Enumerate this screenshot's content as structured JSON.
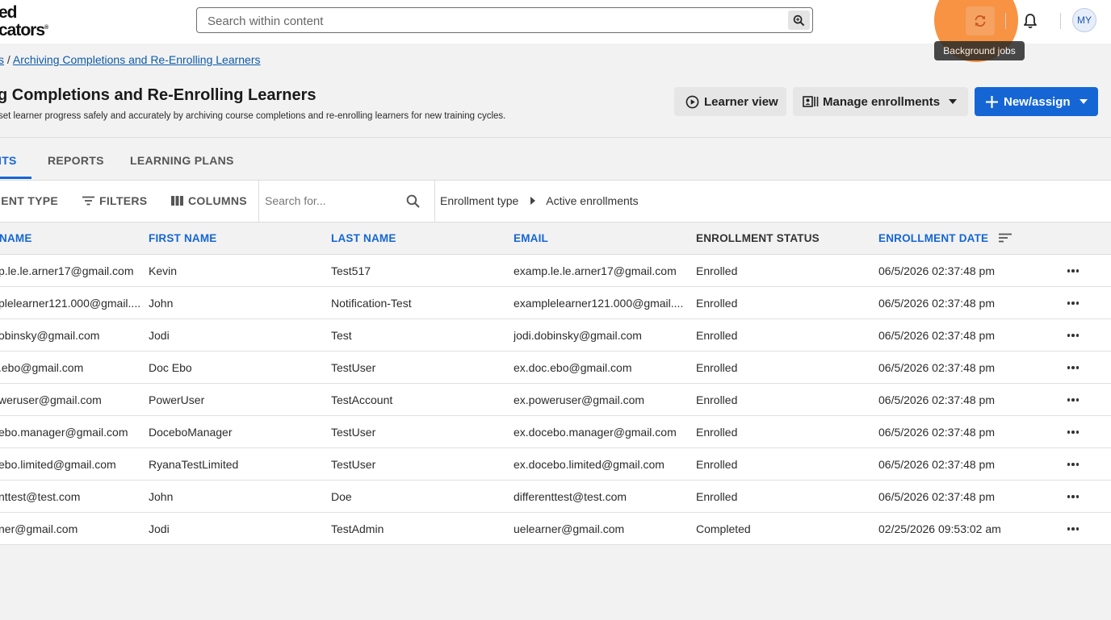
{
  "logo": {
    "line1": "ed",
    "line2": "cators"
  },
  "search": {
    "placeholder": "Search within content"
  },
  "header": {
    "tooltip": "Background jobs",
    "avatar": "MY"
  },
  "breadcrumb": {
    "prefix": "s",
    "separator": "/",
    "current": "Archiving Completions and Re-Enrolling Learners"
  },
  "page": {
    "title": "g Completions and Re-Enrolling Learners",
    "subtitle": "set learner progress safely and accurately by archiving course completions and re-enrolling learners for new training cycles."
  },
  "actions": {
    "learner_view": "Learner view",
    "manage_enrollments": "Manage enrollments",
    "new_assign": "New/assign"
  },
  "tabs": [
    {
      "label": "ITS"
    },
    {
      "label": "REPORTS"
    },
    {
      "label": "LEARNING PLANS"
    }
  ],
  "toolbar": {
    "enrollment_type": "IENT TYPE",
    "filters": "FILTERS",
    "columns": "COLUMNS",
    "search_placeholder": "Search for...",
    "filter_crumb": {
      "type": "Enrollment type",
      "value": "Active enrollments"
    }
  },
  "table": {
    "headers": [
      "NAME",
      "FIRST NAME",
      "LAST NAME",
      "EMAIL",
      "ENROLLMENT STATUS",
      "ENROLLMENT DATE"
    ],
    "rows": [
      [
        "p.le.le.arner17@gmail.com",
        "Kevin",
        "Test517",
        "examp.le.le.arner17@gmail.com",
        "Enrolled",
        "06/5/2026 02:37:48 pm"
      ],
      [
        "plelearner121.000@gmail....",
        "John",
        "Notification-Test",
        "examplelearner121.000@gmail....",
        "Enrolled",
        "06/5/2026 02:37:48 pm"
      ],
      [
        "obinsky@gmail.com",
        "Jodi",
        "Test",
        "jodi.dobinsky@gmail.com",
        "Enrolled",
        "06/5/2026 02:37:48 pm"
      ],
      [
        ".ebo@gmail.com",
        "Doc Ebo",
        "TestUser",
        "ex.doc.ebo@gmail.com",
        "Enrolled",
        "06/5/2026 02:37:48 pm"
      ],
      [
        "weruser@gmail.com",
        "PowerUser",
        "TestAccount",
        "ex.poweruser@gmail.com",
        "Enrolled",
        "06/5/2026 02:37:48 pm"
      ],
      [
        "ebo.manager@gmail.com",
        "DoceboManager",
        "TestUser",
        "ex.docebo.manager@gmail.com",
        "Enrolled",
        "06/5/2026 02:37:48 pm"
      ],
      [
        "ebo.limited@gmail.com",
        "RyanaTestLimited",
        "TestUser",
        "ex.docebo.limited@gmail.com",
        "Enrolled",
        "06/5/2026 02:37:48 pm"
      ],
      [
        "nttest@test.com",
        "John",
        "Doe",
        "differenttest@test.com",
        "Enrolled",
        "06/5/2026 02:37:48 pm"
      ],
      [
        "ner@gmail.com",
        "Jodi",
        "TestAdmin",
        "uelearner@gmail.com",
        "Completed",
        "02/25/2026 09:53:02 am"
      ]
    ]
  },
  "colors": {
    "accent": "#1566d4",
    "highlight": "#f78d38"
  }
}
